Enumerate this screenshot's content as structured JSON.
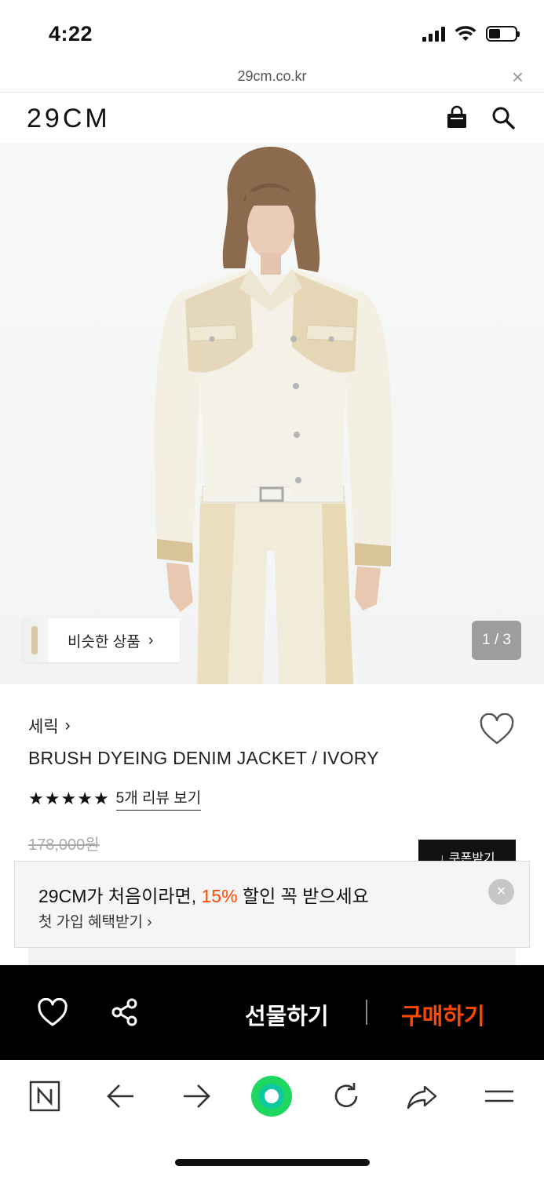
{
  "status_bar": {
    "time": "4:22"
  },
  "url_bar": {
    "url": "29cm.co.kr",
    "close": "×"
  },
  "header": {
    "logo": "29CM"
  },
  "product_image": {
    "similar_label": "비슷한 상품",
    "similar_chevron": "›",
    "page_indicator": "1 / 3"
  },
  "product": {
    "brand": "세릭",
    "brand_chevron": "›",
    "name": "BRUSH DYEING DENIM JACKET / IVORY",
    "rating_stars": 5,
    "review_link": "5개 리뷰 보기",
    "original_price": "178,000원",
    "coupon_label": "↓ 쿠폰받기"
  },
  "promo": {
    "title_prefix": "29CM가 처음이라면, ",
    "title_accent": "15%",
    "title_suffix": " 할인 꼭 받으세요",
    "subtitle": "첫 가입 혜택받기 ›",
    "close": "×"
  },
  "actions": {
    "gift": "선물하기",
    "buy": "구매하기"
  },
  "colors": {
    "accent": "#ff4800",
    "action_bar": "#000000",
    "promo_bg": "#f5f5f5",
    "brand_green": "#1ed760"
  }
}
